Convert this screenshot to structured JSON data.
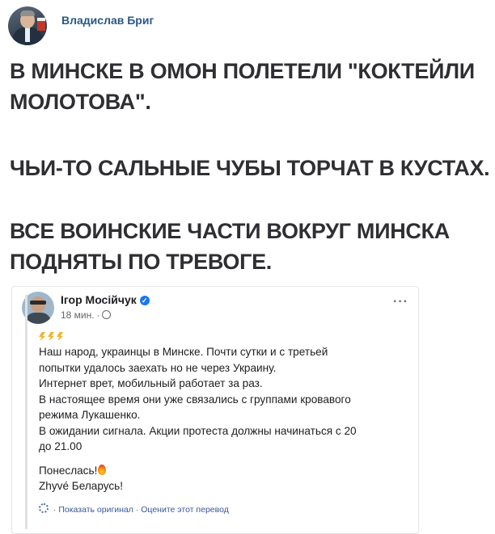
{
  "post": {
    "author": "Владислав Бриг",
    "headline_lines": [
      "В МИНСКЕ В ОМОН ПОЛЕТЕЛИ \"КОКТЕЙЛИ",
      "МОЛОТОВА\".",
      "ЧЬИ-ТО САЛЬНЫЕ ЧУБЫ ТОРЧАТ В КУСТАХ.",
      "ВСЕ ВОИНСКИЕ ЧАСТИ ВОКРУГ МИНСКА",
      "ПОДНЯТЫ ПО ТРЕВОГЕ."
    ]
  },
  "embed": {
    "author": "Ігор Мосійчук",
    "time": "18 мин. ·",
    "more_label": "···",
    "text_lines": [
      "Наш народ, украинцы в Минске. Почти сутки и с третьей",
      "попытки удалось заехать но не через Украину.",
      "Интернет врет, мобильный работает за раз.",
      "В настоящее время они уже связались с группами кровавого",
      "режима Лукашенко.",
      "В ожидании сигнала. Акции протеста должны начинаться с 20",
      "до 21.00"
    ],
    "closing_lines": [
      "Понеслась!",
      "Zhyvé Беларусь!"
    ],
    "show_original": "Показать оригинал",
    "rate_translation": "Оцените этот перевод",
    "separator": " · "
  },
  "colors": {
    "author_link": "#2a5885",
    "headline": "#2f2f33",
    "fb_verified": "#1877f2",
    "fb_link": "#385898",
    "bolt": "#f2b530"
  },
  "icons": [
    "avatar",
    "verified-icon",
    "globe-icon",
    "lightning-icon",
    "fire-emoji-icon",
    "translate-icon"
  ]
}
